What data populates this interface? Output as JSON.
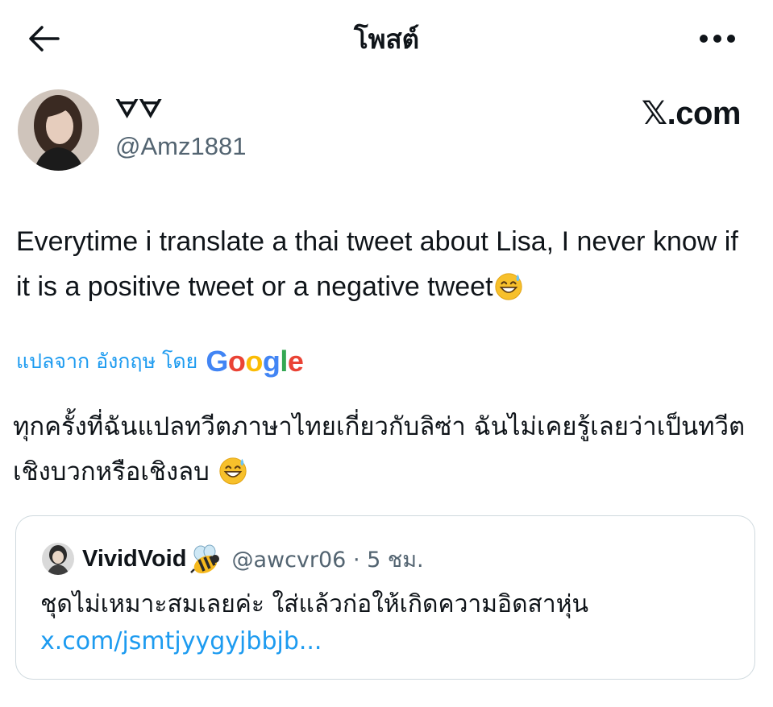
{
  "header": {
    "title": "โพสต์",
    "back_icon": "arrow-left-icon",
    "more_icon": "ellipsis-horizontal-icon"
  },
  "author": {
    "display_name": "ᗊᗊ",
    "handle": "@Amz1881"
  },
  "watermark": "𝕏.com",
  "tweet": {
    "text": "Everytime i translate a thai tweet about Lisa, I never know if it is a positive tweet or a negative tweet",
    "emoji": "grinning-sweat-emoji"
  },
  "translation": {
    "label": "แปลจาก อังกฤษ โดย",
    "provider": {
      "letters": [
        "G",
        "o",
        "o",
        "g",
        "l",
        "e"
      ],
      "colors": [
        "#4285F4",
        "#EA4335",
        "#FBBC05",
        "#4285F4",
        "#34A853",
        "#EA4335"
      ]
    },
    "text": "ทุกครั้งที่ฉันแปลทวีตภาษาไทยเกี่ยวกับลิซ่า ฉันไม่เคยรู้เลยว่าเป็นทวีตเชิงบวกหรือเชิงลบ"
  },
  "quoted": {
    "display_name": "VividVoid",
    "badge_icon": "bee-icon",
    "handle_time": "@awcvr06 · 5 ชม.",
    "text": "ชุดไม่เหมาะสมเลยค่ะ ใส่แล้วก่อให้เกิดความอิดสาหุ่น",
    "link": "x.com/jsmtjyygyjbbjb..."
  },
  "colors": {
    "link": "#1d9bf0",
    "secondary_text": "#536471",
    "primary_text": "#0f1419",
    "border": "#cfd9de"
  }
}
